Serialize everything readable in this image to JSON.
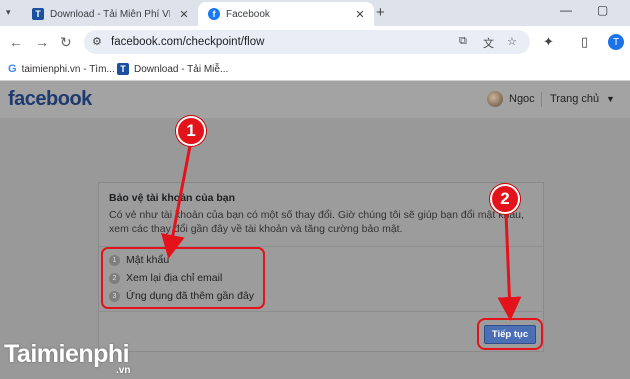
{
  "browser": {
    "tabs": [
      {
        "label": "Download - Tải Miễn Phí VN - ",
        "icon": "taimienphi-icon"
      },
      {
        "label": "Facebook",
        "icon": "facebook-icon"
      }
    ],
    "url": "facebook.com/checkpoint/flow",
    "profile_initial": "T",
    "bookmarks": [
      {
        "label": "taimienphi.vn - Tìm..."
      },
      {
        "label": "Download - Tải Miễ..."
      }
    ]
  },
  "fb_header": {
    "logo": "facebook",
    "user_name": "Ngoc",
    "home_label": "Trang chủ"
  },
  "dialog": {
    "title": "Bảo vệ tài khoản của bạn",
    "description": "Có vẻ như tài khoản của bạn có một số thay đổi. Giờ chúng tôi sẽ giúp bạn đổi mật khẩu, xem các thay đổi gần đây về tài khoản và tăng cường bảo mật.",
    "steps": [
      {
        "num": "1",
        "label": "Mật khẩu"
      },
      {
        "num": "2",
        "label": "Xem lại địa chỉ email"
      },
      {
        "num": "3",
        "label": "Ứng dụng đã thêm gần đây"
      }
    ],
    "continue_label": "Tiếp tục"
  },
  "callouts": [
    "1",
    "2"
  ],
  "watermark": {
    "text": "Taimienphi",
    "suffix": ".vn"
  },
  "colors": {
    "accent_red": "#e3121b",
    "fb_blue": "#4a6fb5"
  }
}
